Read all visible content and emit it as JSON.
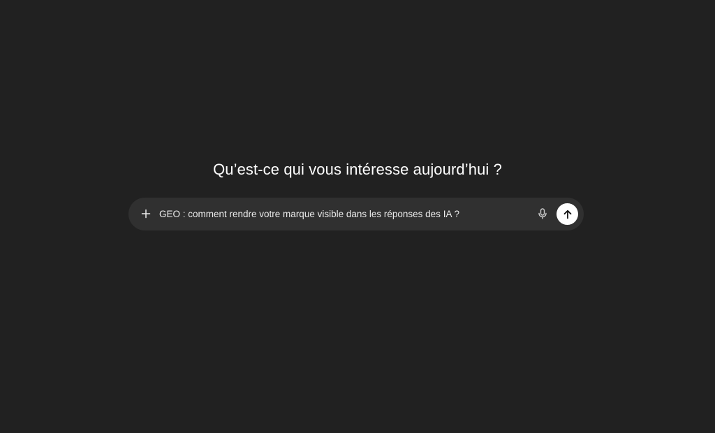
{
  "main": {
    "heading": "Qu’est-ce qui vous intéresse aujourd’hui ?"
  },
  "composer": {
    "prompt_text": "GEO : comment rendre votre marque visible dans les réponses des IA ?",
    "icons": {
      "attach": "plus-icon",
      "voice": "microphone-icon",
      "send": "arrow-up-icon"
    }
  },
  "colors": {
    "background": "#212121",
    "composer_background": "#303030",
    "text": "#ececec",
    "send_button": "#ffffff"
  }
}
